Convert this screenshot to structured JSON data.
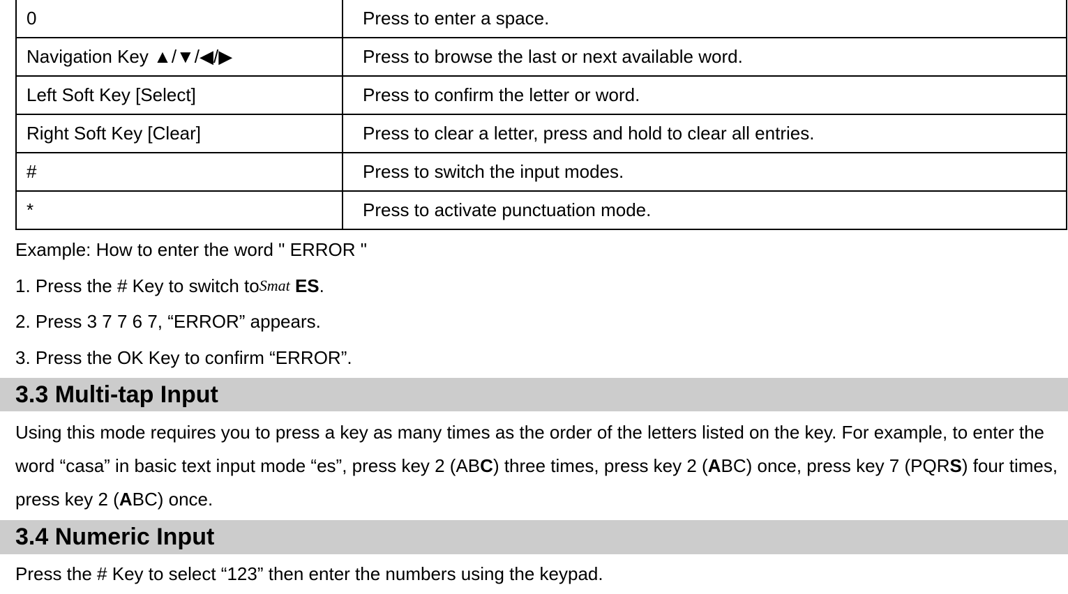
{
  "table": {
    "rows": [
      {
        "key": "0",
        "desc": "Press to enter a space."
      },
      {
        "key": "Navigation Key  ▲/▼/◀/▶",
        "desc": "Press to browse the last or next available word."
      },
      {
        "key": "Left Soft Key [Select]",
        "desc": "Press to confirm the letter or word."
      },
      {
        "key": "Right Soft Key [Clear]",
        "desc": "Press to clear a letter, press and hold to clear all entries."
      },
      {
        "key": "#",
        "desc": "Press to switch the input modes."
      },
      {
        "key": "*",
        "desc": "Press to activate punctuation mode."
      }
    ]
  },
  "example": {
    "intro": "Example: How to enter the word \" ERROR \"",
    "step1_pre": "1. Press the # Key to switch to",
    "step1_glyph": "Smat",
    "step1_post": " ES",
    "step1_post_period": ".",
    "step2": "2. Press 3 7 7 6 7, “ERROR” appears.",
    "step3": "3. Press the OK Key to confirm “ERROR”."
  },
  "section33": {
    "title": "3.3  Multi-tap Input",
    "p1_a": "Using this mode requires you to press a key as many times as the order of the letters listed on the key. For example, to enter the word “casa” in basic text input mode “es”, press key 2 (AB",
    "p1_b": "C",
    "p1_c": ") three times, press key 2 (",
    "p1_d": "A",
    "p1_e": "BC) once, press key 7 (PQR",
    "p1_f": "S",
    "p1_g": ") four times, press key 2 (",
    "p1_h": "A",
    "p1_i": "BC) once."
  },
  "section34": {
    "title": "3.4  Numeric Input",
    "p1": "Press the # Key to select “123” then enter the numbers using the keypad."
  }
}
